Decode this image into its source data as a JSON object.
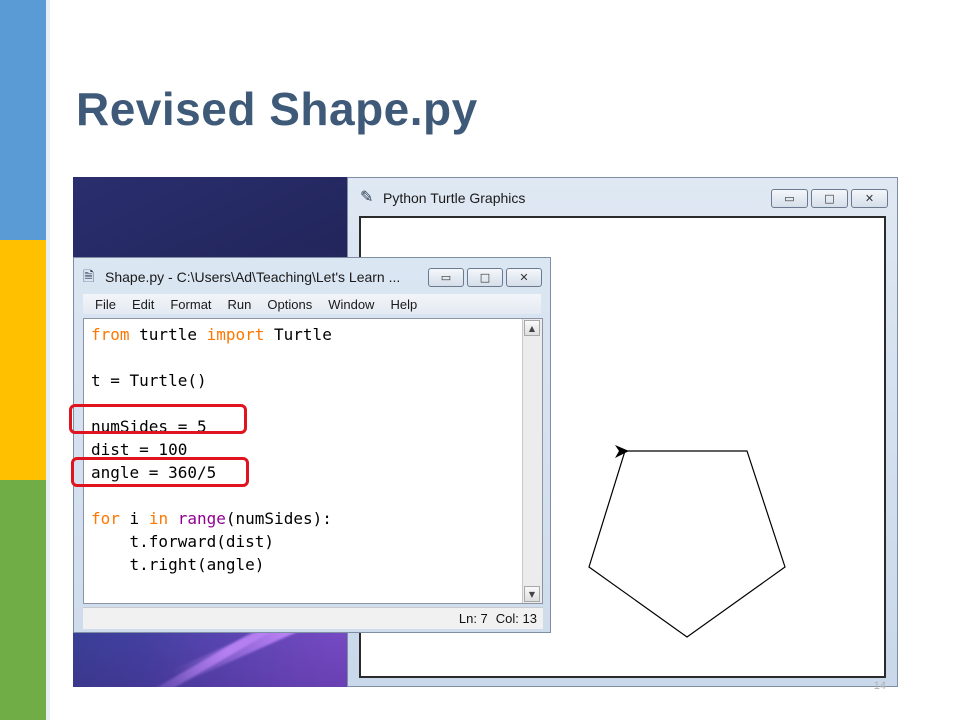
{
  "slide": {
    "title": "Revised Shape.py",
    "page_number": "14",
    "strip_colors": [
      "#5b9bd5",
      "#ffc000",
      "#70ad47"
    ]
  },
  "turtle_window": {
    "title": "Python Turtle Graphics",
    "icon": "feather-icon",
    "buttons": {
      "minimize": "▭",
      "maximize": "□",
      "close": "✕"
    },
    "drawing": {
      "shape": "pentagon",
      "sides": 5,
      "turtle_heading": "east"
    }
  },
  "idle_window": {
    "title": "Shape.py - C:\\Users\\Ad\\Teaching\\Let's Learn ...",
    "icon": "python-file-icon",
    "buttons": {
      "minimize": "▭",
      "maximize": "□",
      "close": "✕"
    },
    "menu": [
      "File",
      "Edit",
      "Format",
      "Run",
      "Options",
      "Window",
      "Help"
    ],
    "code": {
      "line1": {
        "kw1": "from",
        "mod": " turtle ",
        "kw2": "import",
        "name": " Turtle"
      },
      "line3": "t = Turtle()",
      "line5": "numSides = 5",
      "line6": "dist = 100",
      "line7": "angle = 360/5",
      "line9": {
        "kw1": "for",
        "var": " i ",
        "kw2": "in",
        "sp": " ",
        "bi": "range",
        "rest": "(numSides):"
      },
      "line10": "    t.forward(dist)",
      "line11": "    t.right(angle)"
    },
    "status": {
      "line": "Ln: 7",
      "col": "Col: 13"
    }
  },
  "highlight_color": "#e0141e"
}
